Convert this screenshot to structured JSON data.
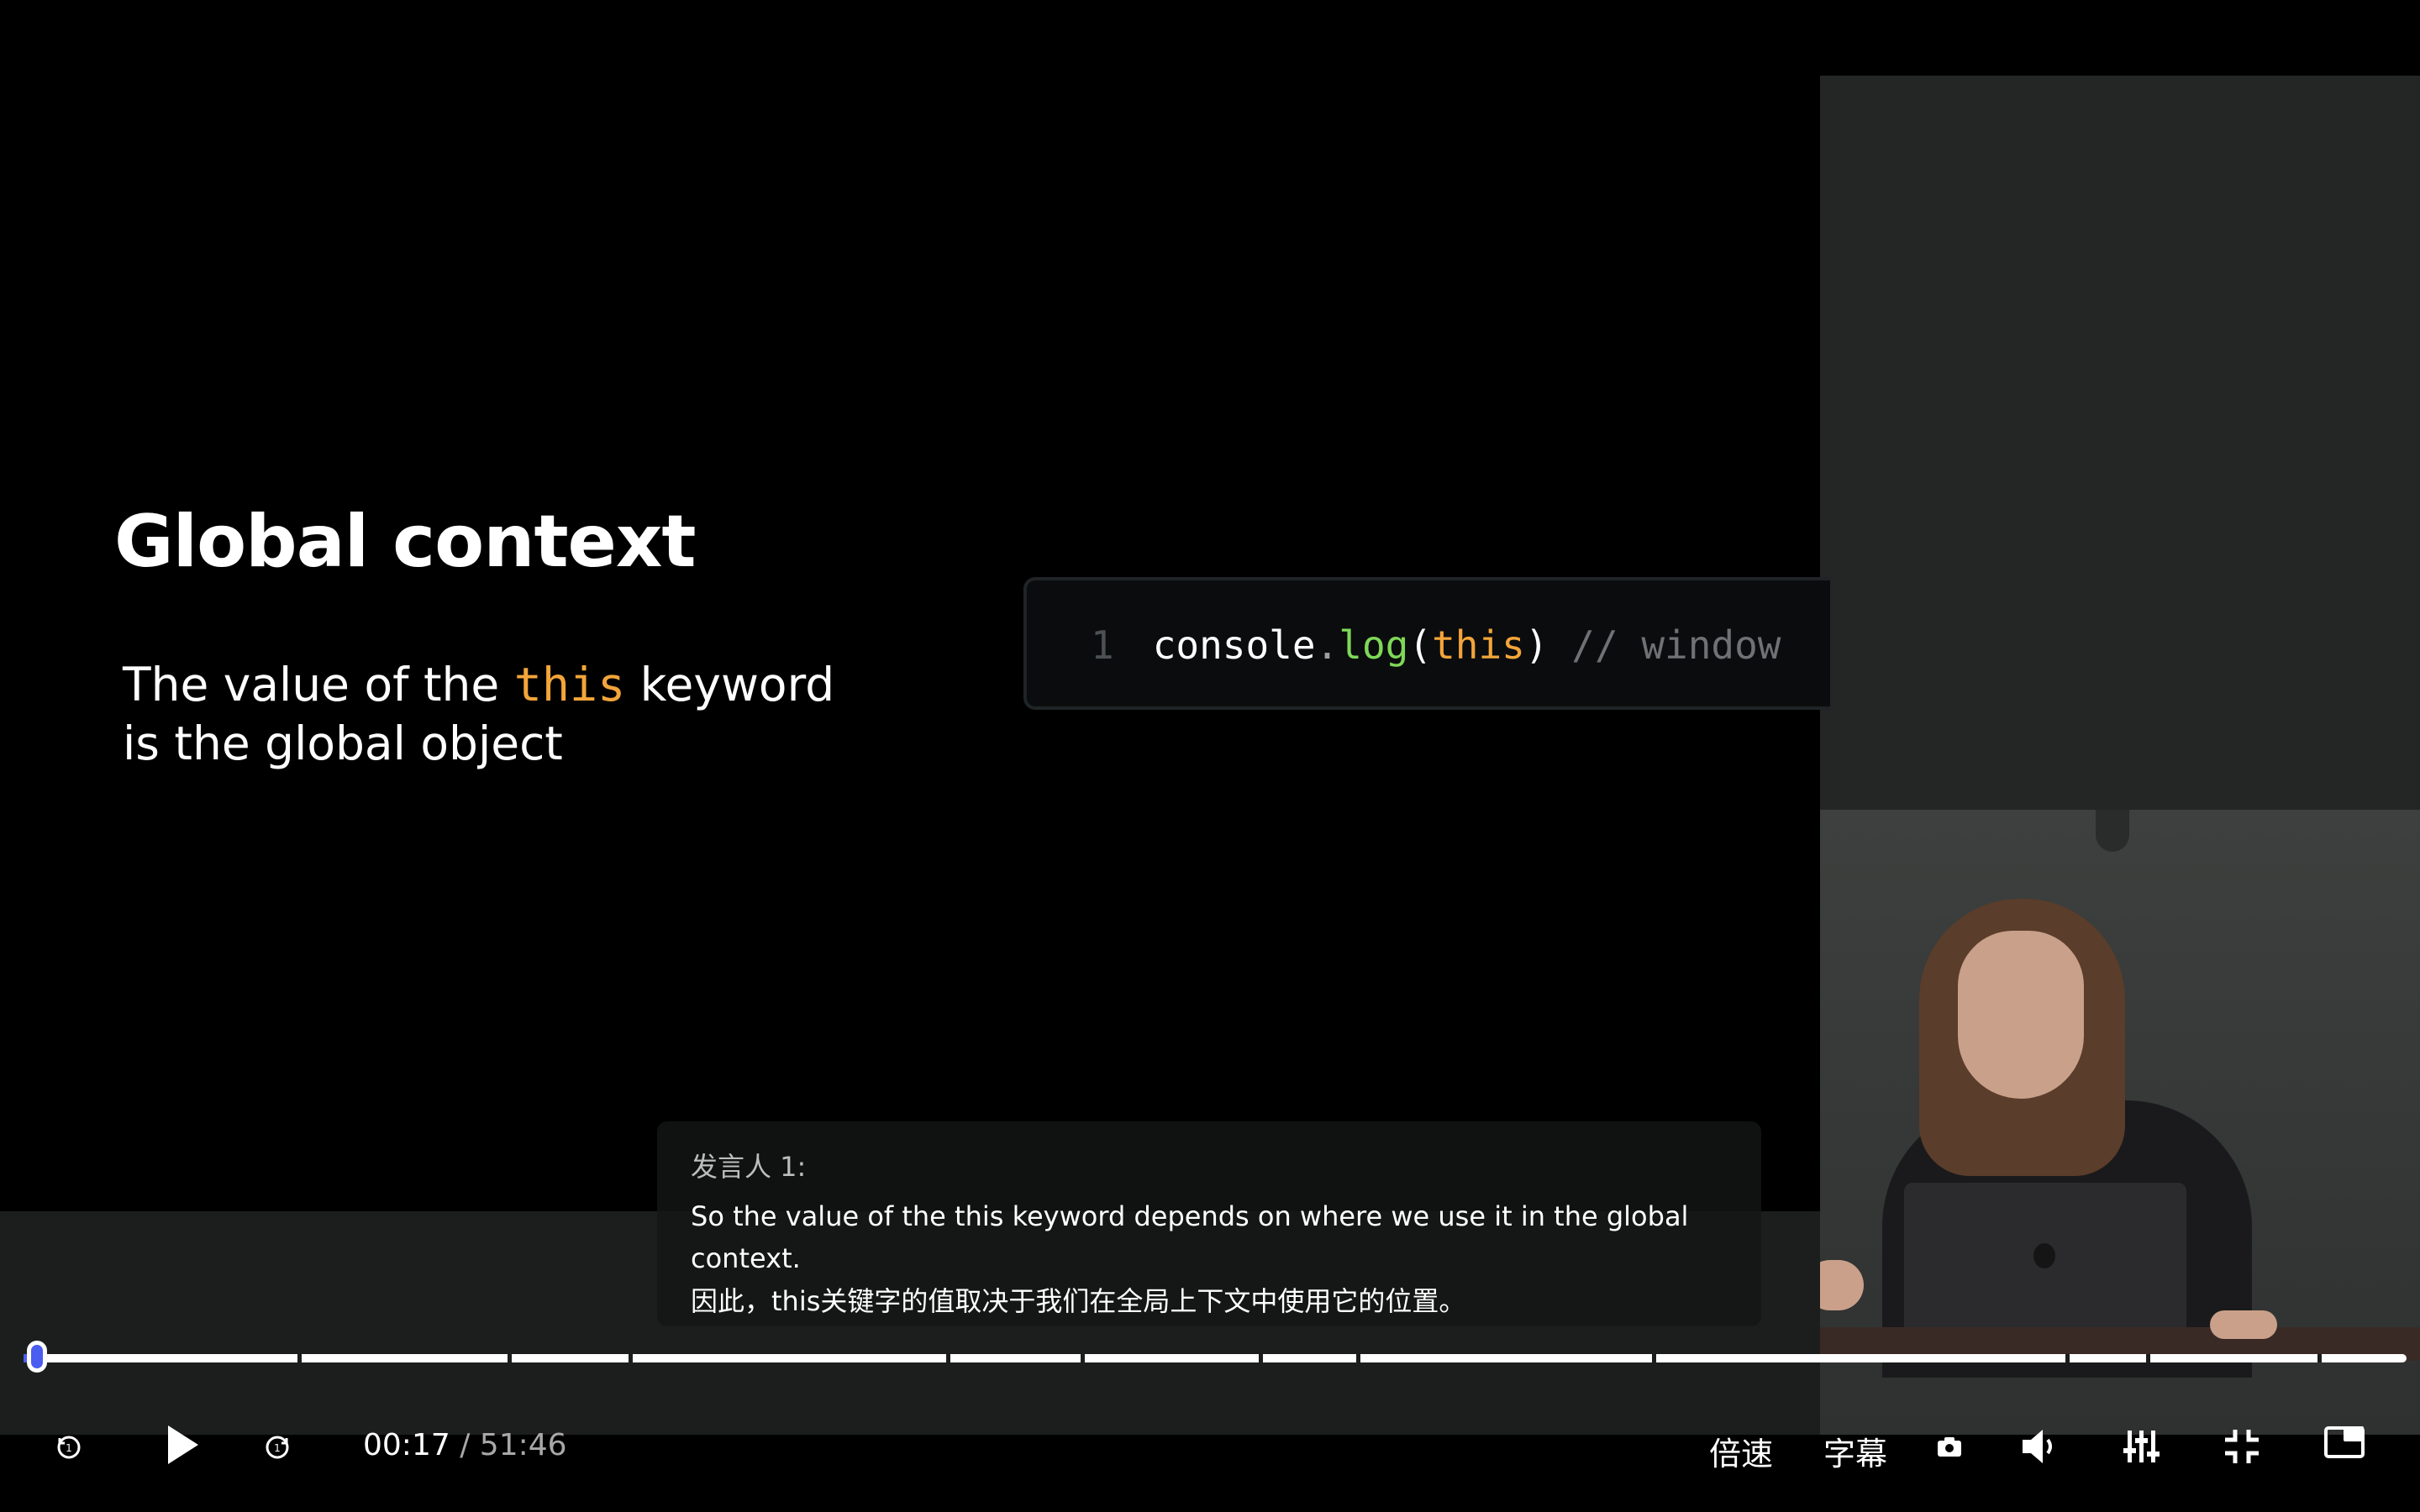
{
  "slide": {
    "title": "Global context",
    "body_before": "The value of the ",
    "body_keyword": "this",
    "body_after_line1": " keyword",
    "body_line2": "is the global object",
    "code": {
      "line_number": "1",
      "object": "console",
      "dot": ".",
      "fn": "log",
      "open_paren": "(",
      "arg": "this",
      "close_paren": ")",
      "comment": " // window"
    }
  },
  "subtitle": {
    "speaker": "发言人 1:",
    "english": "So the value of the this keyword depends on where we use it in the global context.",
    "chinese": "因此，this关键字的值取决于我们在全局上下文中使用它的位置。"
  },
  "player": {
    "current_time": "00:17",
    "separator": "/",
    "duration": "51:46",
    "progress_fraction": 0.0055,
    "speed_label": "倍速",
    "subtitle_label": "字幕",
    "accent_color": "#4b5cf0"
  },
  "controls": {
    "rewind_icon": "rewind-15-icon",
    "play_icon": "play-icon",
    "forward_icon": "forward-15-icon",
    "screenshot_icon": "camera-icon",
    "volume_icon": "volume-icon",
    "settings_icon": "equalizer-icon",
    "exit_fullscreen_icon": "exit-fullscreen-icon",
    "pip_icon": "picture-in-picture-icon"
  }
}
